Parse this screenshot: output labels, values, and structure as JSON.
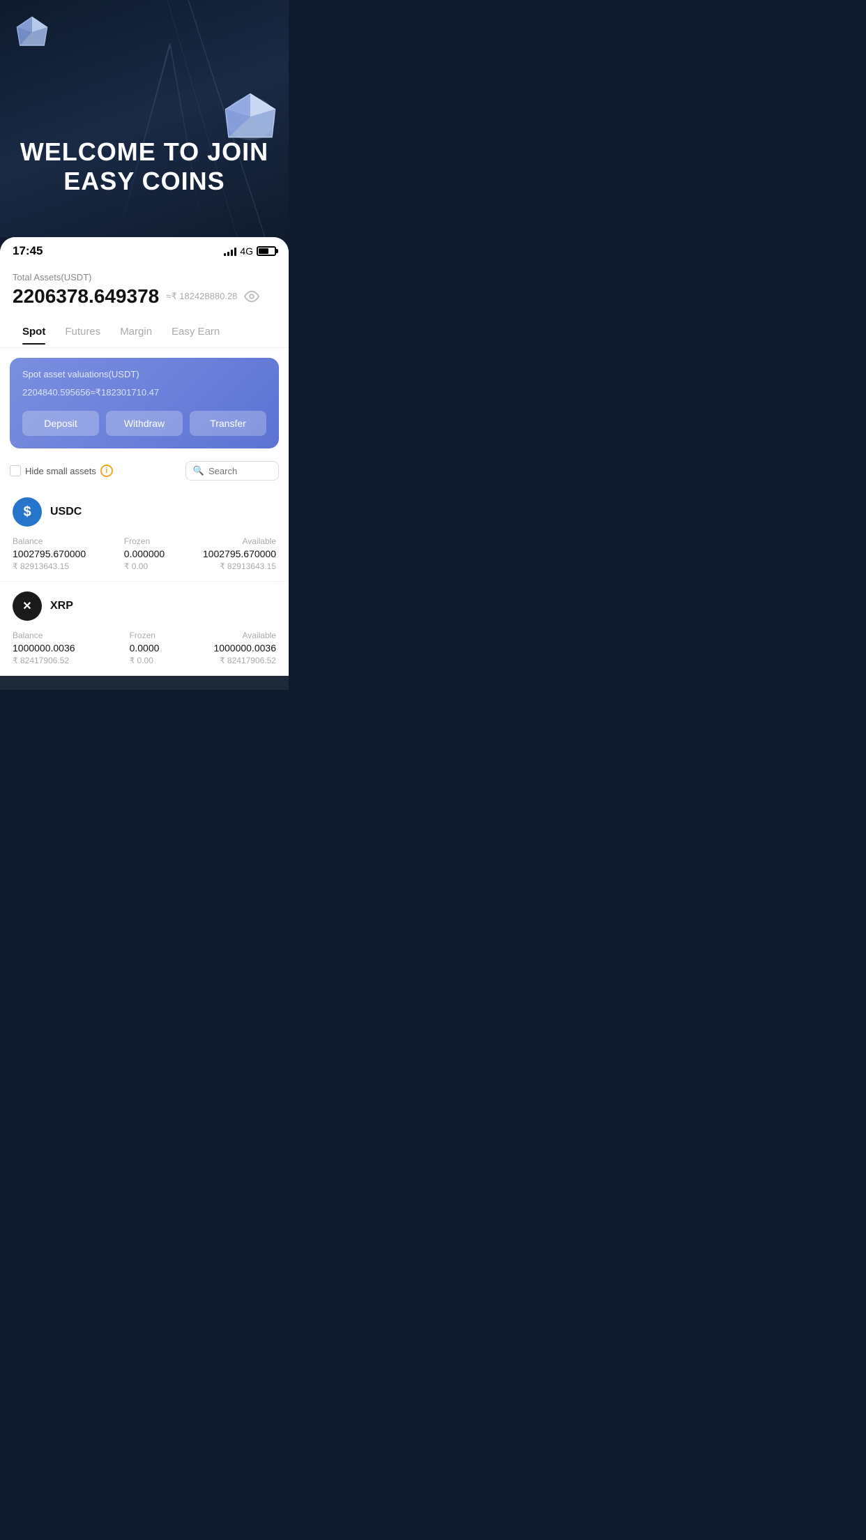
{
  "hero": {
    "title_line1": "WELCOME TO JOIN",
    "title_line2": "EASY COINS"
  },
  "status_bar": {
    "time": "17:45",
    "network": "4G"
  },
  "assets": {
    "label": "Total Assets(USDT)",
    "main_value": "2206378.649378",
    "inr_equiv": "≈₹ 182428880.28"
  },
  "tabs": [
    {
      "label": "Spot",
      "active": true
    },
    {
      "label": "Futures",
      "active": false
    },
    {
      "label": "Margin",
      "active": false
    },
    {
      "label": "Easy Earn",
      "active": false
    }
  ],
  "spot_card": {
    "label": "Spot asset valuations(USDT)",
    "value": "2204840.595656",
    "inr": "≈₹182301710.47",
    "btn_deposit": "Deposit",
    "btn_withdraw": "Withdraw",
    "btn_transfer": "Transfer"
  },
  "filter": {
    "hide_label": "Hide small assets",
    "search_placeholder": "Search"
  },
  "coins": [
    {
      "symbol": "USDC",
      "logo_text": "$",
      "logo_class": "usdc",
      "balance_label": "Balance",
      "balance_value": "1002795.670000",
      "balance_inr": "₹ 82913643.15",
      "frozen_label": "Frozen",
      "frozen_value": "0.000000",
      "frozen_inr": "₹ 0.00",
      "available_label": "Available",
      "available_value": "1002795.670000",
      "available_inr": "₹ 82913643.15"
    },
    {
      "symbol": "XRP",
      "logo_text": "✕",
      "logo_class": "xrp",
      "balance_label": "Balance",
      "balance_value": "1000000.0036",
      "balance_inr": "₹ 82417906.52",
      "frozen_label": "Frozen",
      "frozen_value": "0.0000",
      "frozen_inr": "₹ 0.00",
      "available_label": "Available",
      "available_value": "1000000.0036",
      "available_inr": "₹ 82417906.52"
    }
  ]
}
